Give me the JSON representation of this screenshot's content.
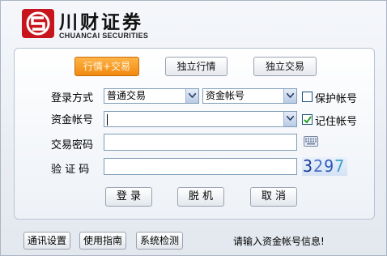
{
  "brand": {
    "title": "川财证券",
    "subtitle": "CHUANCAI SECURITIES",
    "logo_color": "#c8151d"
  },
  "modes": {
    "items": [
      {
        "label": "行情+交易",
        "active": true
      },
      {
        "label": "独立行情",
        "active": false
      },
      {
        "label": "独立交易",
        "active": false
      }
    ]
  },
  "form": {
    "login_method_label": "登录方式",
    "login_method_value": "普通交易",
    "account_type_value": "资金帐号",
    "protect_account_label": "保护帐号",
    "protect_account_checked": false,
    "account_label": "资金帐号",
    "account_value": "",
    "remember_account_label": "记住帐号",
    "remember_account_checked": true,
    "password_label": "交易密码",
    "captcha_label": "验 证 码",
    "captcha_digits": [
      "3",
      "2",
      "9",
      "7"
    ]
  },
  "actions": {
    "login": "登 录",
    "offline": "脱 机",
    "cancel": "取 消"
  },
  "footer": {
    "comm_settings": "通讯设置",
    "user_guide": "使用指南",
    "system_check": "系统检测",
    "status_text": "请输入资金帐号信息!"
  },
  "icons": {
    "keyboard": "keyboard-icon",
    "dropdown": "chevron-down-icon",
    "check": "check-icon"
  },
  "colors": {
    "active_mode": "#f08a10",
    "input_border": "#7f9db9"
  }
}
